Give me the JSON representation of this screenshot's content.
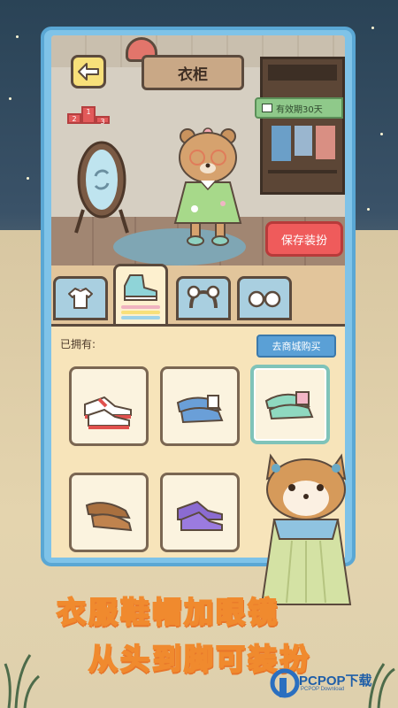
{
  "header": {
    "title": "衣柜",
    "help_label": "?",
    "podium_labels": [
      "2",
      "1",
      "3"
    ],
    "validity_label": "有效期30天"
  },
  "actions": {
    "save_label": "保存装扮",
    "shop_label": "去商城购买"
  },
  "tabs": [
    {
      "name": "clothes",
      "icon": "shirt-icon",
      "active": false
    },
    {
      "name": "shoes",
      "icon": "shoe-icon",
      "active": true
    },
    {
      "name": "headwear",
      "icon": "headband-icon",
      "active": false
    },
    {
      "name": "glasses",
      "icon": "glasses-icon",
      "active": false
    }
  ],
  "inventory": {
    "owned_label": "已拥有:",
    "items": [
      {
        "name": "red-white-sneakers",
        "selected": false
      },
      {
        "name": "blue-white-slip-ons",
        "selected": false
      },
      {
        "name": "mint-pink-slip-ons",
        "selected": true
      },
      {
        "name": "brown-loafers",
        "selected": false
      },
      {
        "name": "purple-sneakers",
        "selected": false
      }
    ]
  },
  "promo": {
    "line1": "衣服鞋帽加眼镜",
    "line2": "从头到脚可装扮"
  },
  "watermark": {
    "brand": "PCPOP下载",
    "sub": "PCPOP Download"
  },
  "colors": {
    "accent_red": "#ef5b5b",
    "accent_blue": "#5aa0d6",
    "frame_blue": "#7fc3e8",
    "panel": "#f7e4ba",
    "slogan_outline": "#f08a2e"
  }
}
